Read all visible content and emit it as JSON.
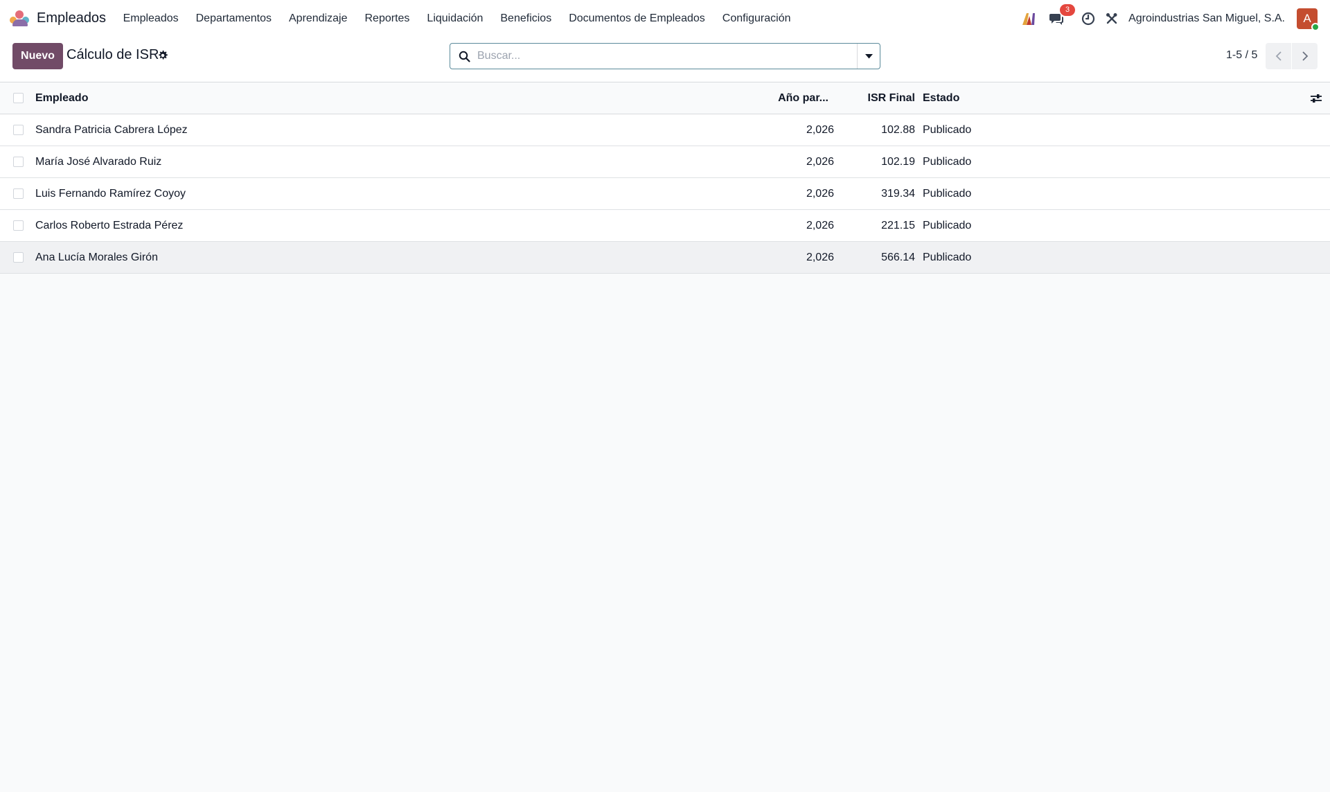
{
  "navbar": {
    "app_name": "Empleados",
    "menu": [
      "Empleados",
      "Departamentos",
      "Aprendizaje",
      "Reportes",
      "Liquidación",
      "Beneficios",
      "Documentos de Empleados",
      "Configuración"
    ],
    "messages_count": "3",
    "company": "Agroindustrias San Miguel, S.A.",
    "avatar_letter": "A"
  },
  "control_panel": {
    "new_label": "Nuevo",
    "title": "Cálculo de ISR",
    "search_placeholder": "Buscar...",
    "pager": "1-5 / 5"
  },
  "table": {
    "headers": {
      "employee": "Empleado",
      "year": "Año par...",
      "isr_final": "ISR Final",
      "state": "Estado"
    },
    "rows": [
      {
        "employee": "Sandra Patricia Cabrera López",
        "year": "2,026",
        "isr_final": "102.88",
        "state": "Publicado"
      },
      {
        "employee": "María José Alvarado Ruiz",
        "year": "2,026",
        "isr_final": "102.19",
        "state": "Publicado"
      },
      {
        "employee": "Luis Fernando Ramírez Coyoy",
        "year": "2,026",
        "isr_final": "319.34",
        "state": "Publicado"
      },
      {
        "employee": "Carlos Roberto Estrada Pérez",
        "year": "2,026",
        "isr_final": "221.15",
        "state": "Publicado"
      },
      {
        "employee": "Ana Lucía Morales Girón",
        "year": "2,026",
        "isr_final": "566.14",
        "state": "Publicado"
      }
    ]
  },
  "colors": {
    "primary": "#714b67",
    "badge": "#e4473e",
    "avatar": "#c44d2f",
    "online": "#28a745"
  },
  "icons": [
    "employees-app-logo",
    "ai-icon",
    "chat-icon",
    "clock-icon",
    "tools-icon",
    "gear-icon",
    "search-icon",
    "caret-down-icon",
    "chevron-left-icon",
    "chevron-right-icon",
    "column-settings-icon"
  ]
}
